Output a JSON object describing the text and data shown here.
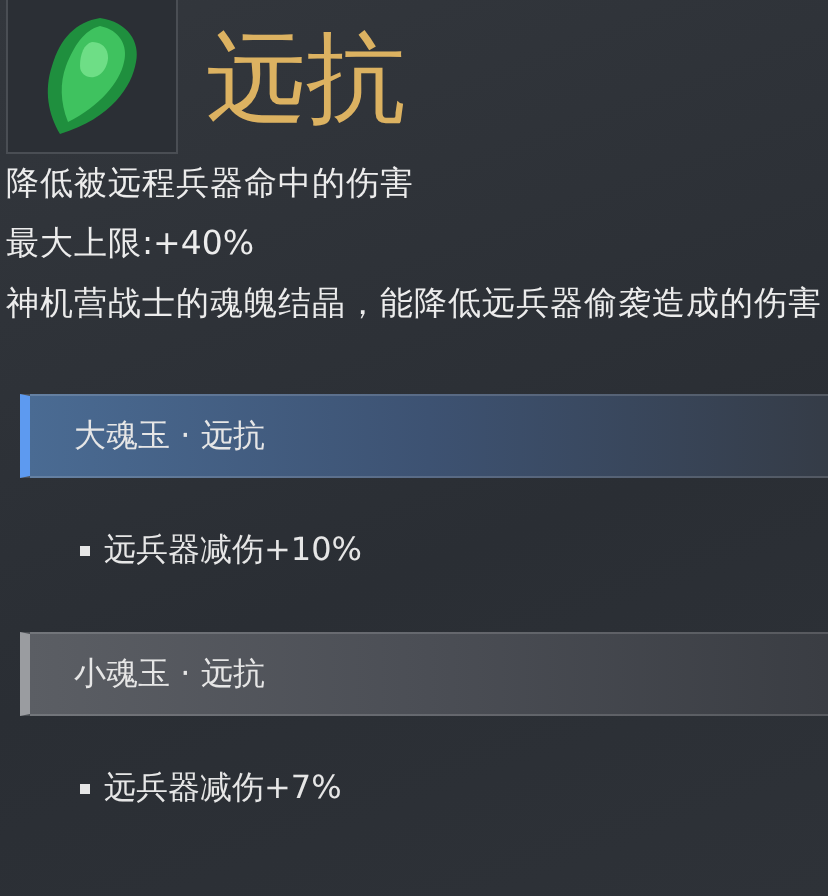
{
  "item": {
    "name": "远抗",
    "lines": [
      "降低被远程兵器命中的伤害",
      "最大上限:+40%",
      "神机营战士的魂魄结晶，能降低远兵器偷袭造成的伤害"
    ]
  },
  "tiers": [
    {
      "kind": "large",
      "title": "大魂玉 · 远抗",
      "effects": [
        "远兵器减伤+10%"
      ]
    },
    {
      "kind": "small",
      "title": "小魂玉 · 远抗",
      "effects": [
        "远兵器减伤+7%"
      ]
    }
  ]
}
